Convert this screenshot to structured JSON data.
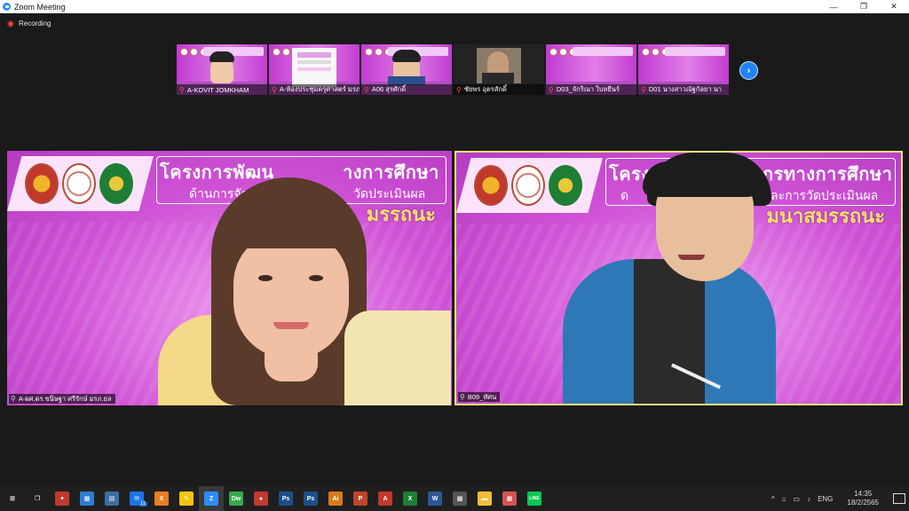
{
  "window": {
    "title": "Zoom Meeting",
    "controls": [
      "—",
      "❐",
      "✕"
    ]
  },
  "recording": {
    "label": "Recording"
  },
  "thumbnails": [
    {
      "name": "A-KOVIT JOMKHAM",
      "kind": "person"
    },
    {
      "name": "A-ห้องประชุมครุศาสตร์ มรภ.ยล",
      "kind": "slide"
    },
    {
      "name": "A06 สุรศักดิ์",
      "kind": "person"
    },
    {
      "name": "ชัยพร อุตรสักดิ์",
      "kind": "dark"
    },
    {
      "name": "D03_จักริณา ใบหยีนร์",
      "kind": "banner"
    },
    {
      "name": "D01 นางสาวณัฐกัลยา นา",
      "kind": "banner"
    }
  ],
  "next_button": "›",
  "main_videos": [
    {
      "name": "A-ผศ.ดร.ขนิษฐา ศรีรักษ์ มรภ.ยล",
      "banner_title": "โครงการพัฒน",
      "banner_title2": "างการศึกษา",
      "banner_sub": "ด้านการจัด",
      "banner_sub2": "วัดประเมินผล",
      "banner_big": "มรรถนะ"
    },
    {
      "name": "B09_ทัศน",
      "banner_title": "โครง",
      "banner_title2": "กรทางการศึกษา",
      "banner_sub": "ด",
      "banner_sub2": "และการวัดประเมินผล",
      "banner_big": "มนาสมรรถนะ"
    }
  ],
  "taskbar": {
    "apps": [
      {
        "icon": "windows-start-icon",
        "label": "⊞",
        "color": "#1f1f1f"
      },
      {
        "icon": "task-view-icon",
        "label": "❐",
        "color": "#1f1f1f"
      },
      {
        "icon": "game-icon",
        "label": "✦",
        "color": "#c0392b"
      },
      {
        "icon": "calendar-icon",
        "label": "▦",
        "color": "#2d7dd2"
      },
      {
        "icon": "calculator-icon",
        "label": "▤",
        "color": "#3a6ea5"
      },
      {
        "icon": "mail-icon",
        "label": "✉",
        "color": "#1a73e8"
      },
      {
        "icon": "xampp-icon",
        "label": "X",
        "color": "#e67e22"
      },
      {
        "icon": "pen-app-icon",
        "label": "✎",
        "color": "#f1c40f"
      },
      {
        "icon": "zoom-icon",
        "label": "Z",
        "color": "#2D8CFF"
      },
      {
        "icon": "dreamweaver-icon",
        "label": "Dw",
        "color": "#35a84a"
      },
      {
        "icon": "browser-icon",
        "label": "●",
        "color": "#c0392b"
      },
      {
        "icon": "photoshop-icon",
        "label": "Ps",
        "color": "#1b4f8a"
      },
      {
        "icon": "photoshop2-icon",
        "label": "Ps",
        "color": "#1b4f8a"
      },
      {
        "icon": "illustrator-icon",
        "label": "Ai",
        "color": "#d97a19"
      },
      {
        "icon": "powerpoint-icon",
        "label": "P",
        "color": "#c0442b"
      },
      {
        "icon": "acrobat-icon",
        "label": "A",
        "color": "#c0392b"
      },
      {
        "icon": "excel-icon",
        "label": "X",
        "color": "#1e7e34"
      },
      {
        "icon": "word-icon",
        "label": "W",
        "color": "#2b5797"
      },
      {
        "icon": "qr-icon",
        "label": "▩",
        "color": "#555"
      },
      {
        "icon": "file-explorer-icon",
        "label": "▬",
        "color": "#f2c037"
      },
      {
        "icon": "app-grid-icon",
        "label": "▦",
        "color": "#d35454"
      },
      {
        "icon": "line-icon",
        "label": "LINE",
        "color": "#06c755"
      }
    ],
    "mail_badge": "11",
    "tray_icons": [
      "^",
      "⌂",
      "▭",
      "♪"
    ],
    "language": "ENG",
    "time": "14:35",
    "date": "18/2/2565"
  },
  "colors": {
    "accent": "#2D8CFF",
    "active_speaker": "#e4e57c",
    "recording": "#f04438"
  }
}
